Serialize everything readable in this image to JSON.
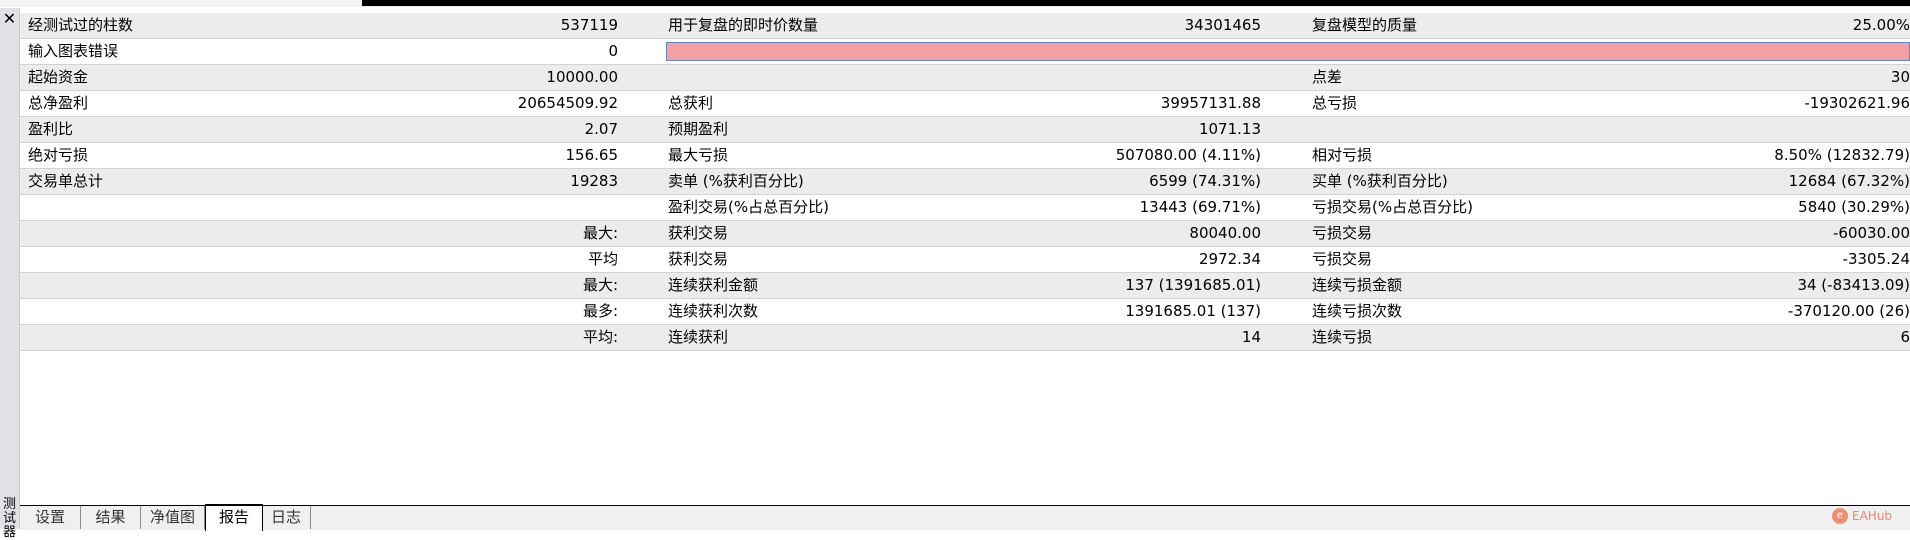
{
  "window": {
    "close_glyph": "✕",
    "side_label": "测试器"
  },
  "report_rows": [
    {
      "shade": "g",
      "l1": "经测试过的柱数",
      "v1": "537119",
      "l2": "用于复盘的即时价数量",
      "v2": "34301465",
      "l3": "复盘模型的质量",
      "v3": "25.00%"
    },
    {
      "shade": "w",
      "l1": "输入图表错误",
      "v1": "0",
      "error_bar": true,
      "l2": "",
      "v2": "",
      "l3": "",
      "v3": ""
    },
    {
      "shade": "g",
      "l1": "起始资金",
      "v1": "10000.00",
      "l2": "",
      "v2": "",
      "l3": "点差",
      "v3": "30"
    },
    {
      "shade": "w",
      "l1": "总净盈利",
      "v1": "20654509.92",
      "l2": "总获利",
      "v2": "39957131.88",
      "l3": "总亏损",
      "v3": "-19302621.96"
    },
    {
      "shade": "g",
      "l1": "盈利比",
      "v1": "2.07",
      "l2": "预期盈利",
      "v2": "1071.13",
      "l3": "",
      "v3": ""
    },
    {
      "shade": "w",
      "l1": "绝对亏损",
      "v1": "156.65",
      "l2": "最大亏损",
      "v2": "507080.00 (4.11%)",
      "l3": "相对亏损",
      "v3": "8.50% (12832.79)"
    },
    {
      "shade": "g",
      "l1": "交易单总计",
      "v1": "19283",
      "l2": "卖单 (%获利百分比)",
      "v2": "6599 (74.31%)",
      "l3": "买单 (%获利百分比)",
      "v3": "12684 (67.32%)"
    },
    {
      "shade": "w",
      "l1": "",
      "v1": "",
      "l2": "盈利交易(%占总百分比)",
      "v2": "13443 (69.71%)",
      "l3": "亏损交易(%占总百分比)",
      "v3": "5840 (30.29%)"
    },
    {
      "shade": "g",
      "l1": "",
      "v1": "最大:",
      "l2": "获利交易",
      "v2": "80040.00",
      "l3": "亏损交易",
      "v3": "-60030.00"
    },
    {
      "shade": "w",
      "l1": "",
      "v1": "平均",
      "l2": "获利交易",
      "v2": "2972.34",
      "l3": "亏损交易",
      "v3": "-3305.24"
    },
    {
      "shade": "g",
      "l1": "",
      "v1": "最大:",
      "l2": "连续获利金额",
      "v2": "137 (1391685.01)",
      "l3": "连续亏损金额",
      "v3": "34 (-83413.09)"
    },
    {
      "shade": "w",
      "l1": "",
      "v1": "最多:",
      "l2": "连续获利次数",
      "v2": "1391685.01 (137)",
      "l3": "连续亏损次数",
      "v3": "-370120.00 (26)"
    },
    {
      "shade": "g",
      "l1": "",
      "v1": "平均:",
      "l2": "连续获利",
      "v2": "14",
      "l3": "连续亏损",
      "v3": "6"
    }
  ],
  "tabs": [
    {
      "label": "设置",
      "active": false
    },
    {
      "label": "结果",
      "active": false
    },
    {
      "label": "净值图",
      "active": false
    },
    {
      "label": "报告",
      "active": true
    },
    {
      "label": "日志",
      "active": false
    }
  ],
  "watermark": {
    "text": "EAHub",
    "logo_glyph": "e"
  }
}
